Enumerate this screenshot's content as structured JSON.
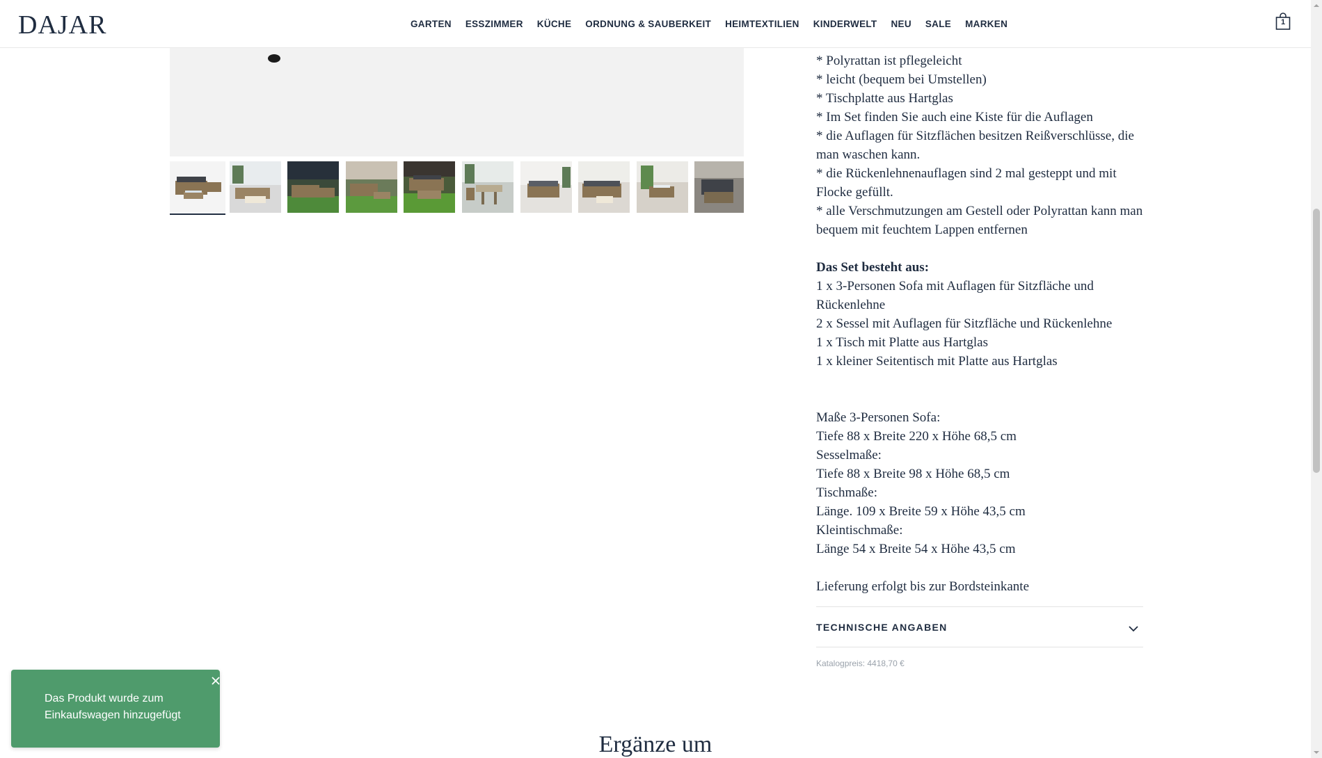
{
  "header": {
    "logo": "DAJAR",
    "nav": [
      "GARTEN",
      "ESSZIMMER",
      "KÜCHE",
      "ORDNUNG & SAUBERKEIT",
      "HEIMTEXTILIEN",
      "KINDERWELT",
      "NEU",
      "SALE",
      "MARKEN"
    ],
    "cart_count": "1"
  },
  "gallery": {
    "thumbnail_count": 10,
    "active_thumbnail": 1
  },
  "description": {
    "features": [
      "* Polyrattan ist pflegeleicht",
      "* leicht (bequem bei Umstellen)",
      "* Tischplatte aus Hartglas",
      "* Im Set finden Sie auch eine Kiste für die Auflagen",
      "* die Auflagen für Sitzflächen besitzen Reißverschlüsse, die man waschen kann.",
      "* die Rückenlehnenauflagen sind 2 mal gesteppt und mit Flocke gefüllt.",
      "* alle Verschmutzungen am Gestell oder Polyrattan kann man bequem mit feuchtem Lappen entfernen"
    ],
    "set_heading": "Das Set besteht aus:",
    "set_items": [
      "1 x 3-Personen Sofa mit Auflagen für Sitzfläche und Rückenlehne",
      "2 x Sessel mit Auflagen für Sitzfläche und Rückenlehne",
      "1 x Tisch mit Platte aus Hartglas",
      "1 x kleiner Seitentisch mit Platte aus Hartglas"
    ],
    "dimensions": [
      "Maße 3-Personen Sofa:",
      "Tiefe 88 x Breite 220 x Höhe 68,5 cm",
      "Sesselmaße:",
      "Tiefe 88 x Breite 98 x Höhe 68,5 cm",
      "Tischmaße:",
      "Länge. 109 x Breite 59 x Höhe 43,5 cm",
      "Kleintischmaße:",
      "Länge 54 x Breite 54 x Höhe 43,5 cm"
    ],
    "delivery": "Lieferung erfolgt bis zur Bordsteinkante"
  },
  "accordion": {
    "title": "TECHNISCHE ANGABEN"
  },
  "catalog_price": "Katalogpreis: 4418,70 €",
  "section_title": "Ergänze um",
  "toast": {
    "message": "Das Produkt wurde zum Einkaufswagen hinzugefügt"
  },
  "colors": {
    "accent": "#1f2c40",
    "toast": "#4f9b6c"
  },
  "icons": [
    "bag-icon",
    "chevron-down-icon",
    "close-icon"
  ]
}
